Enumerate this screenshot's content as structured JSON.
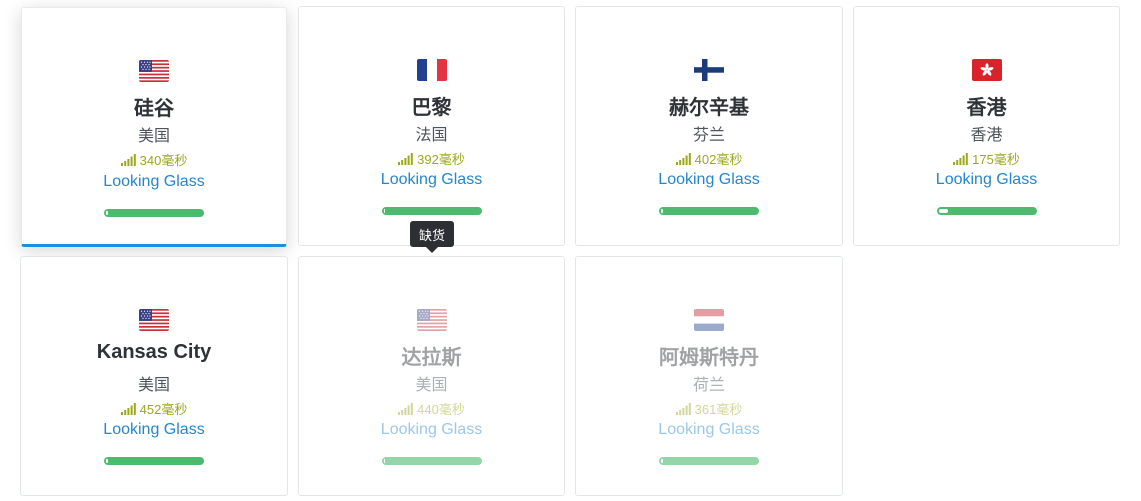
{
  "tooltip": {
    "text": "缺货"
  },
  "colors": {
    "accent": "#1a8fe0",
    "link": "#2486cf",
    "ping": "#9ca71f",
    "bar": "#4cbb6e",
    "tooltip_bg": "#2c2f33"
  },
  "locations": [
    {
      "city": "硅谷",
      "country": "美国",
      "ping": "340毫秒",
      "link": "Looking Glass",
      "flag": "us-flag-icon",
      "load_percent": 2,
      "selected": true,
      "available": true
    },
    {
      "city": "巴黎",
      "country": "法国",
      "ping": "392毫秒",
      "link": "Looking Glass",
      "flag": "fr-flag-icon",
      "load_percent": 2,
      "selected": false,
      "available": true
    },
    {
      "city": "赫尔辛基",
      "country": "芬兰",
      "ping": "402毫秒",
      "link": "Looking Glass",
      "flag": "fi-flag-icon",
      "load_percent": 2,
      "selected": false,
      "available": true
    },
    {
      "city": "香港",
      "country": "香港",
      "ping": "175毫秒",
      "link": "Looking Glass",
      "flag": "hk-flag-icon",
      "load_percent": 10,
      "selected": false,
      "available": true
    },
    {
      "city": "Kansas City",
      "country": "美国",
      "ping": "452毫秒",
      "link": "Looking Glass",
      "flag": "us-flag-icon",
      "load_percent": 2,
      "selected": false,
      "available": true
    },
    {
      "city": "达拉斯",
      "country": "美国",
      "ping": "440毫秒",
      "link": "Looking Glass",
      "flag": "us-flag-icon",
      "load_percent": 2,
      "selected": false,
      "available": false
    },
    {
      "city": "阿姆斯特丹",
      "country": "荷兰",
      "ping": "361毫秒",
      "link": "Looking Glass",
      "flag": "nl-flag-icon",
      "load_percent": 2,
      "selected": false,
      "available": false
    }
  ]
}
